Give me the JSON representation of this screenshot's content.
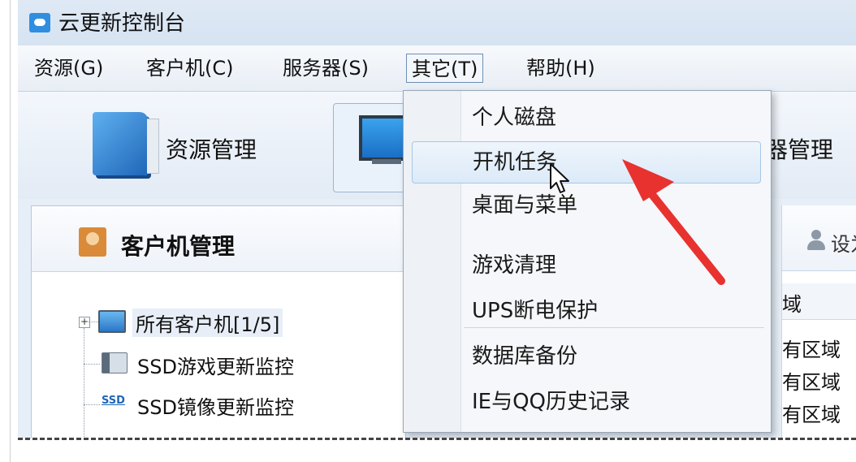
{
  "window": {
    "title": "云更新控制台"
  },
  "menu": [
    {
      "label": "资源(G)"
    },
    {
      "label": "客户机(C)"
    },
    {
      "label": "服务器(S)"
    },
    {
      "label": "其它(T)"
    },
    {
      "label": "帮助(H)"
    }
  ],
  "toolbar": {
    "resource_label": "资源管理",
    "server_label_partial": "器管理"
  },
  "panel": {
    "title": "客户机管理",
    "tree": [
      {
        "label": "所有客户机[1/5]"
      },
      {
        "label": "SSD游戏更新监控"
      },
      {
        "label": "SSD镜像更新监控"
      }
    ],
    "ssd_badge": "SSD"
  },
  "right": {
    "action_partial": "设为",
    "column_partial": "域",
    "rows": [
      "有区域",
      "有区域",
      "有区域"
    ]
  },
  "dropdown": {
    "items": [
      {
        "label": "个人磁盘"
      },
      {
        "label": "开机任务"
      },
      {
        "label": "桌面与菜单"
      },
      {
        "label": "游戏清理"
      },
      {
        "label": "UPS断电保护"
      },
      {
        "label": "数据库备份"
      },
      {
        "label": "IE与QQ历史记录"
      }
    ],
    "hovered_item": "开机任务"
  },
  "annotation": {
    "arrow_color": "#e8322f"
  }
}
